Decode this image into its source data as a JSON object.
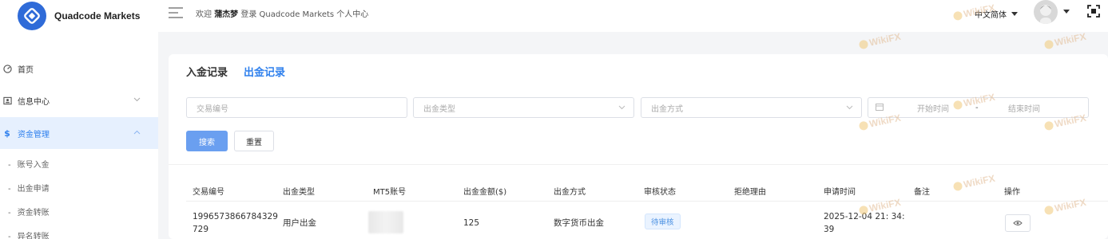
{
  "brand": {
    "name": "Quadcode Markets"
  },
  "sidebar": {
    "items": [
      {
        "label": "首页",
        "icon": "dashboard-icon"
      },
      {
        "label": "信息中心",
        "icon": "id-card-icon"
      },
      {
        "label": "资金管理",
        "icon": "dollar-icon"
      }
    ],
    "sub_items": [
      {
        "label": "账号入金"
      },
      {
        "label": "出金申请"
      },
      {
        "label": "资金转账"
      },
      {
        "label": "异名转账"
      }
    ]
  },
  "header": {
    "welcome_prefix": "欢迎",
    "username": "蒲杰梦",
    "welcome_suffix": "登录 Quadcode Markets 个人中心",
    "language": "中文简体"
  },
  "tabs": [
    {
      "label": "入金记录",
      "active": false
    },
    {
      "label": "出金记录",
      "active": true
    }
  ],
  "filters": {
    "transaction_id_placeholder": "交易编号",
    "withdraw_type_placeholder": "出金类型",
    "withdraw_method_placeholder": "出金方式",
    "start_date_placeholder": "开始时间",
    "date_separator": "-",
    "end_date_placeholder": "结束时间",
    "search_label": "搜索",
    "reset_label": "重置"
  },
  "table": {
    "columns": [
      "交易编号",
      "出金类型",
      "MT5账号",
      "出金金额($)",
      "出金方式",
      "审核状态",
      "拒绝理由",
      "申请时间",
      "备注",
      "操作"
    ],
    "rows": [
      {
        "transaction_id_line1": "1996573866784329",
        "transaction_id_line2": "729",
        "withdraw_type": "用户出金",
        "mt5_account": "",
        "amount": "125",
        "method": "数字货币出金",
        "status": "待审核",
        "reject_reason": "",
        "apply_time_line1": "2025-12-04 21: 34:",
        "apply_time_line2": "39",
        "remark": ""
      }
    ]
  },
  "watermark": {
    "text": "WikiFX"
  },
  "colors": {
    "accent": "#2f80ed",
    "primary_button": "#6a9ff0",
    "active_nav_bg": "#e6f0fe",
    "brand_logo": "#2f6bd8"
  }
}
